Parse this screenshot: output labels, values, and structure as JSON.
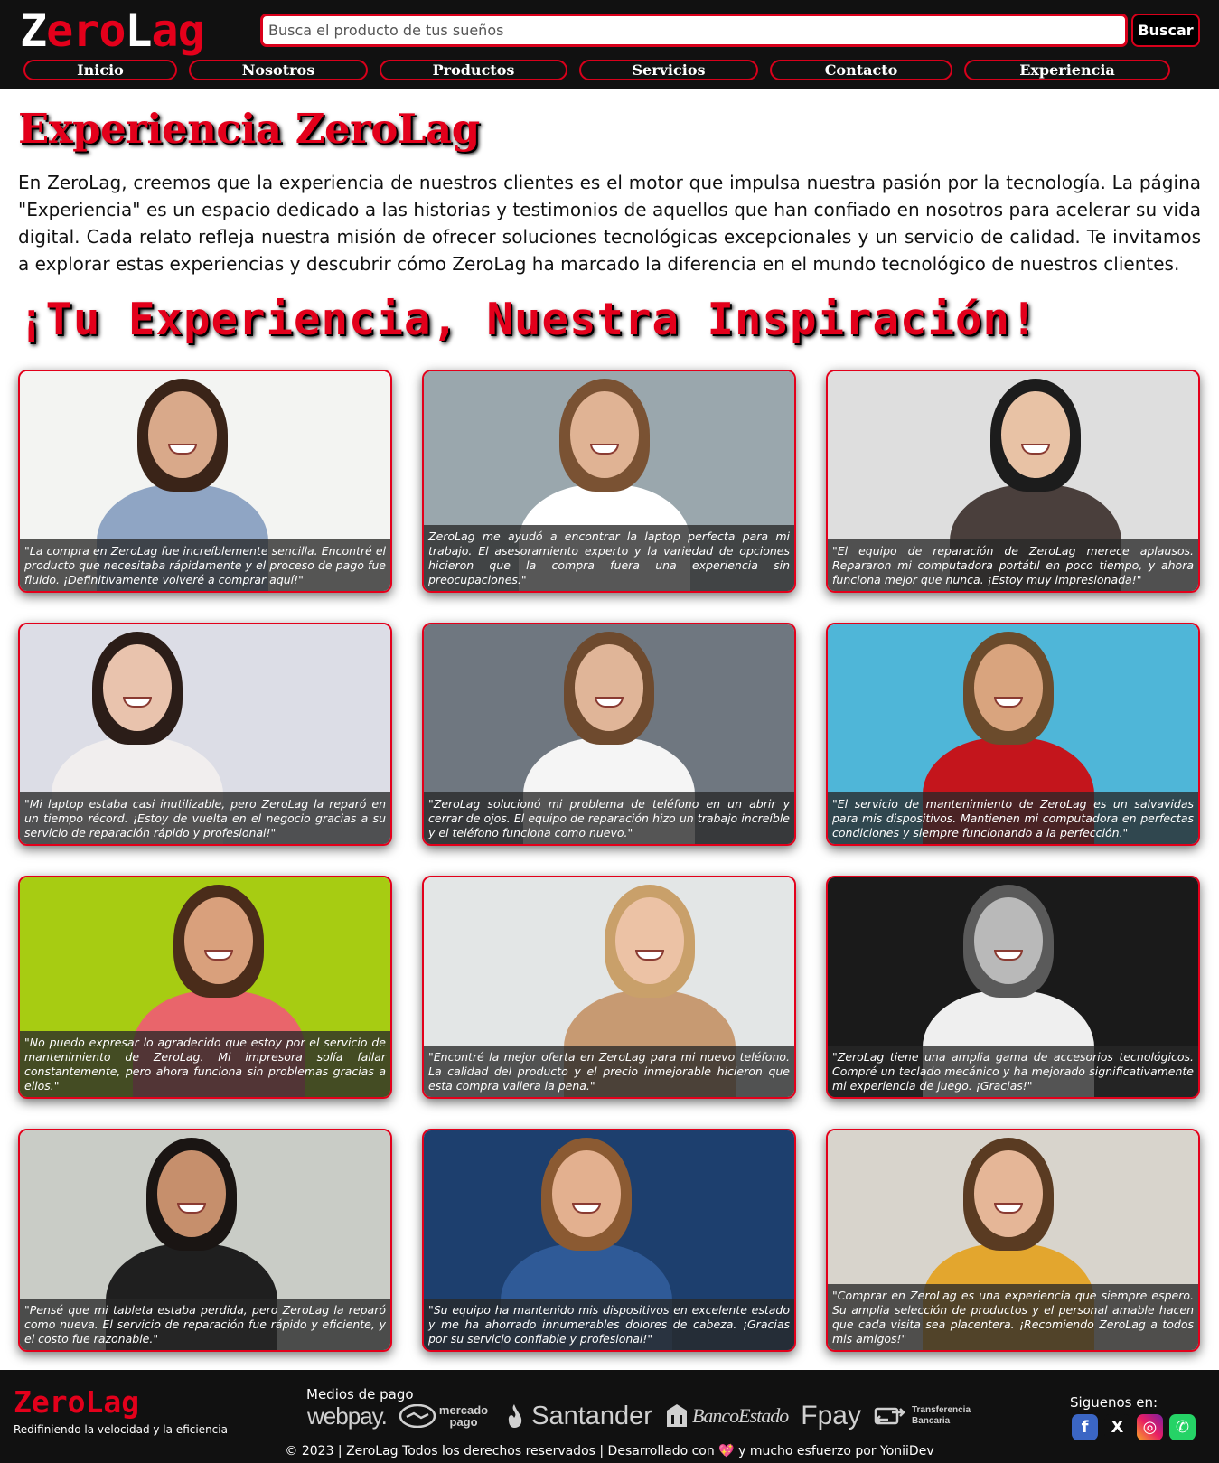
{
  "brand": {
    "logo_part1": "Zero",
    "logo_part2": "Lag",
    "logo_letter_white_1": "Z",
    "logo_rest_1": "ero",
    "logo_letter_white_2": "L",
    "logo_rest_2": "ag"
  },
  "search": {
    "placeholder": "Busca el producto de tus sueños",
    "button_label": "Buscar"
  },
  "nav": {
    "items": [
      "Inicio",
      "Nosotros",
      "Productos",
      "Servicios",
      "Contacto",
      "Experiencia"
    ]
  },
  "page": {
    "title": "Experiencia ZeroLag",
    "intro": "En ZeroLag, creemos que la experiencia de nuestros clientes es el motor que impulsa nuestra pasión por la tecnología. La página \"Experiencia\" es un espacio dedicado a las historias y testimonios de aquellos que han confiado en nosotros para acelerar su vida digital. Cada relato refleja nuestra misión de ofrecer soluciones tecnológicas excepcionales y un servicio de calidad. Te invitamos a explorar estas experiencias y descubrir cómo ZeroLag ha marcado la diferencia en el mundo tecnológico de nuestros clientes.",
    "subtitle": "¡Tu Experiencia, Nuestra Inspiración!"
  },
  "testimonials": [
    {
      "text": "\"La compra en ZeroLag fue increíblemente sencilla. Encontré el producto que necesitaba rápidamente y el proceso de pago fue fluido. ¡Definitivamente volveré a comprar aquí!\"",
      "bg": "#f3f4f2",
      "skin": "#d9a98a",
      "hair": "#3a2418",
      "shirt": "#8fa5c4"
    },
    {
      "text": "ZeroLag me ayudó a encontrar la laptop perfecta para mi trabajo. El asesoramiento experto y la variedad de opciones hicieron que la compra fuera una experiencia sin preocupaciones.\"",
      "bg": "#9aa7ad",
      "skin": "#e0b394",
      "hair": "#7a5233",
      "shirt": "#ffffff"
    },
    {
      "text": "\"El equipo de reparación de ZeroLag merece aplausos. Repararon mi computadora portátil en poco tiempo, y ahora funciona mejor que nunca. ¡Estoy muy impresionada!\"",
      "bg": "#dedede",
      "skin": "#e8c2a5",
      "hair": "#1c1c1c",
      "shirt": "#4a3f3c"
    },
    {
      "text": "\"Mi laptop estaba casi inutilizable, pero ZeroLag la reparó en un tiempo récord. ¡Estoy de vuelta en el negocio gracias a su servicio de reparación rápido y profesional!\"",
      "bg": "#dcdde6",
      "skin": "#e9c3ad",
      "hair": "#2b1d18",
      "shirt": "#f1eeee"
    },
    {
      "text": "\"ZeroLag solucionó mi problema de teléfono en un abrir y cerrar de ojos. El equipo de reparación hizo un trabajo increíble y el teléfono funciona como nuevo.\"",
      "bg": "#6f7780",
      "skin": "#e0b598",
      "hair": "#6e4a2e",
      "shirt": "#f5f5f5"
    },
    {
      "text": "\"El servicio de mantenimiento de ZeroLag es un salvavidas para mis dispositivos. Mantienen mi computadora en perfectas condiciones y siempre funcionando a la perfección.\"",
      "bg": "#4fb6d8",
      "skin": "#d9a47e",
      "hair": "#6b4b2c",
      "shirt": "#c4151c"
    },
    {
      "text": "\"No puedo expresar lo agradecido que estoy por el servicio de mantenimiento de ZeroLag. Mi impresora solía fallar constantemente, pero ahora funciona sin problemas gracias a ellos.\"",
      "bg": "#a7cc12",
      "skin": "#d9a07c",
      "hair": "#4a2c1a",
      "shirt": "#e9656b"
    },
    {
      "text": "\"Encontré la mejor oferta en ZeroLag para mi nuevo teléfono. La calidad del producto y el precio inmejorable hicieron que esta compra valiera la pena.\"",
      "bg": "#e3e6e6",
      "skin": "#ecc2a5",
      "hair": "#c9a06a",
      "shirt": "#c79a72"
    },
    {
      "text": "\"ZeroLag tiene una amplia gama de accesorios tecnológicos. Compré un teclado mecánico y ha mejorado significativamente mi experiencia de juego. ¡Gracias!\"",
      "bg": "#1a1a1a",
      "skin": "#b9b9b9",
      "hair": "#5a5a5a",
      "shirt": "#efefef"
    },
    {
      "text": "\"Pensé que mi tableta estaba perdida, pero ZeroLag la reparó como nueva. El servicio de reparación fue rápido y eficiente, y el costo fue razonable.\"",
      "bg": "#c9ccc6",
      "skin": "#c68f6c",
      "hair": "#1a1513",
      "shirt": "#1f1f1f"
    },
    {
      "text": "\"Su equipo ha mantenido mis dispositivos en excelente estado y me ha ahorrado innumerables dolores de cabeza. ¡Gracias por su servicio confiable y profesional!\"",
      "bg": "#1d3f6e",
      "skin": "#e3b08f",
      "hair": "#8b5a32",
      "shirt": "#2f5a97"
    },
    {
      "text": "\"Comprar en ZeroLag es una experiencia que siempre espero. Su amplia selección de productos y el personal amable hacen que cada visita sea placentera. ¡Recomiendo ZeroLag a todos mis amigos!\"",
      "bg": "#d8d4cc",
      "skin": "#e5b697",
      "hair": "#5a3b22",
      "shirt": "#e3a62e"
    }
  ],
  "footer": {
    "logo": "ZeroLag",
    "tagline": "Redifiniendo la velocidad y la eficiencia",
    "payments_title": "Medios de pago",
    "payments": {
      "webpay": "webpay.",
      "mercadopago_1": "mercado",
      "mercadopago_2": "pago",
      "santander": "Santander",
      "bancoestado": "BancoEstado",
      "fpay": "Fpay",
      "transferencia_1": "Transferencia",
      "transferencia_2": "Bancaria"
    },
    "follow_label": "Siguenos en:",
    "socials": [
      {
        "name": "facebook",
        "glyph": "f",
        "color": "#3b66c4"
      },
      {
        "name": "x",
        "glyph": "X",
        "color": "#111111"
      },
      {
        "name": "instagram",
        "glyph": "◎",
        "color": "#d6336c"
      },
      {
        "name": "whatsapp",
        "glyph": "✆",
        "color": "#25d366"
      }
    ],
    "copyright_pre": "© 2023 | ZeroLag Todos los derechos reservados | Desarrollado con",
    "copyright_heart": "💖",
    "copyright_post": "y mucho esfuerzo por YoniiDev"
  }
}
